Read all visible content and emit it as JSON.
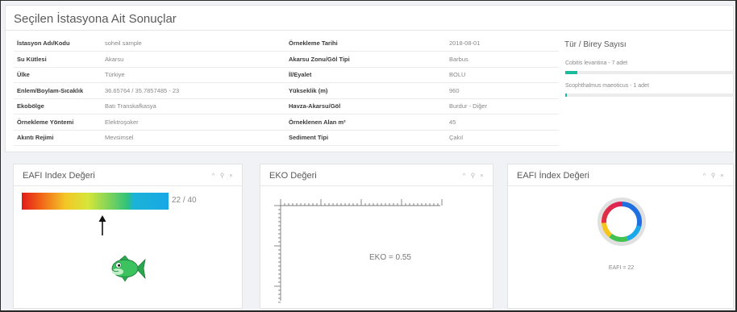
{
  "top": {
    "title": "Seçilen İstasyona Ait Sonuçlar",
    "rows": [
      {
        "l1": "İstasyon Adı/Kodu",
        "v1": "soheil sample",
        "l2": "Örnekleme Tarihi",
        "v2": "2018-08-01"
      },
      {
        "l1": "Su Kütlesi",
        "v1": "Akarsu",
        "l2": "Akarsu Zonu/Göl Tipi",
        "v2": "Barbus"
      },
      {
        "l1": "Ülke",
        "v1": "Türkiye",
        "l2": "İl/Eyalet",
        "v2": "BOLU"
      },
      {
        "l1": "Enlem/Boylam-Sıcaklık",
        "v1": "36.65764 / 35.7857485 - 23",
        "l2": "Yükseklik (m)",
        "v2": "960"
      },
      {
        "l1": "Ekobölge",
        "v1": "Batı Transkafkasya",
        "l2": "Havza-Akarsu/Göl",
        "v2": "Burdur - Diğer"
      },
      {
        "l1": "Örnekleme Yöntemi",
        "v1": "Elektroşoker",
        "l2": "Örneklenen Alan m²",
        "v2": "45"
      },
      {
        "l1": "Akıntı Rejimi",
        "v1": "Mevsimsel",
        "l2": "Sediment Tipi",
        "v2": "Çakıl"
      }
    ]
  },
  "species": {
    "title": "Tür / Birey Sayısı",
    "items": [
      {
        "label": "Cobitis levantina - 7 adet",
        "fraction": 0.07
      },
      {
        "label": "Scophthalmus maeoticus - 1 adet",
        "fraction": 0.01
      }
    ],
    "bar_color": "#1abc9c"
  },
  "card1": {
    "title": "EAFI Index Değeri",
    "value_text": "22 / 40",
    "tools": [
      "^",
      "⚲",
      "×"
    ],
    "score": 22,
    "max": 40
  },
  "card2": {
    "title": "EKO Değeri",
    "label": "EKO = 0.55",
    "tools": [
      "^",
      "⚲",
      "×"
    ]
  },
  "card3": {
    "title": "EAFI İndex Değeri",
    "caption": "EAFI = 22",
    "tools": [
      "^",
      "⚲",
      "×"
    ]
  },
  "icons": {
    "arrow": "arrow-up-icon",
    "fish": "fish-icon",
    "collapse": "chevron-up-icon",
    "wrench": "wrench-icon",
    "close": "close-icon"
  }
}
